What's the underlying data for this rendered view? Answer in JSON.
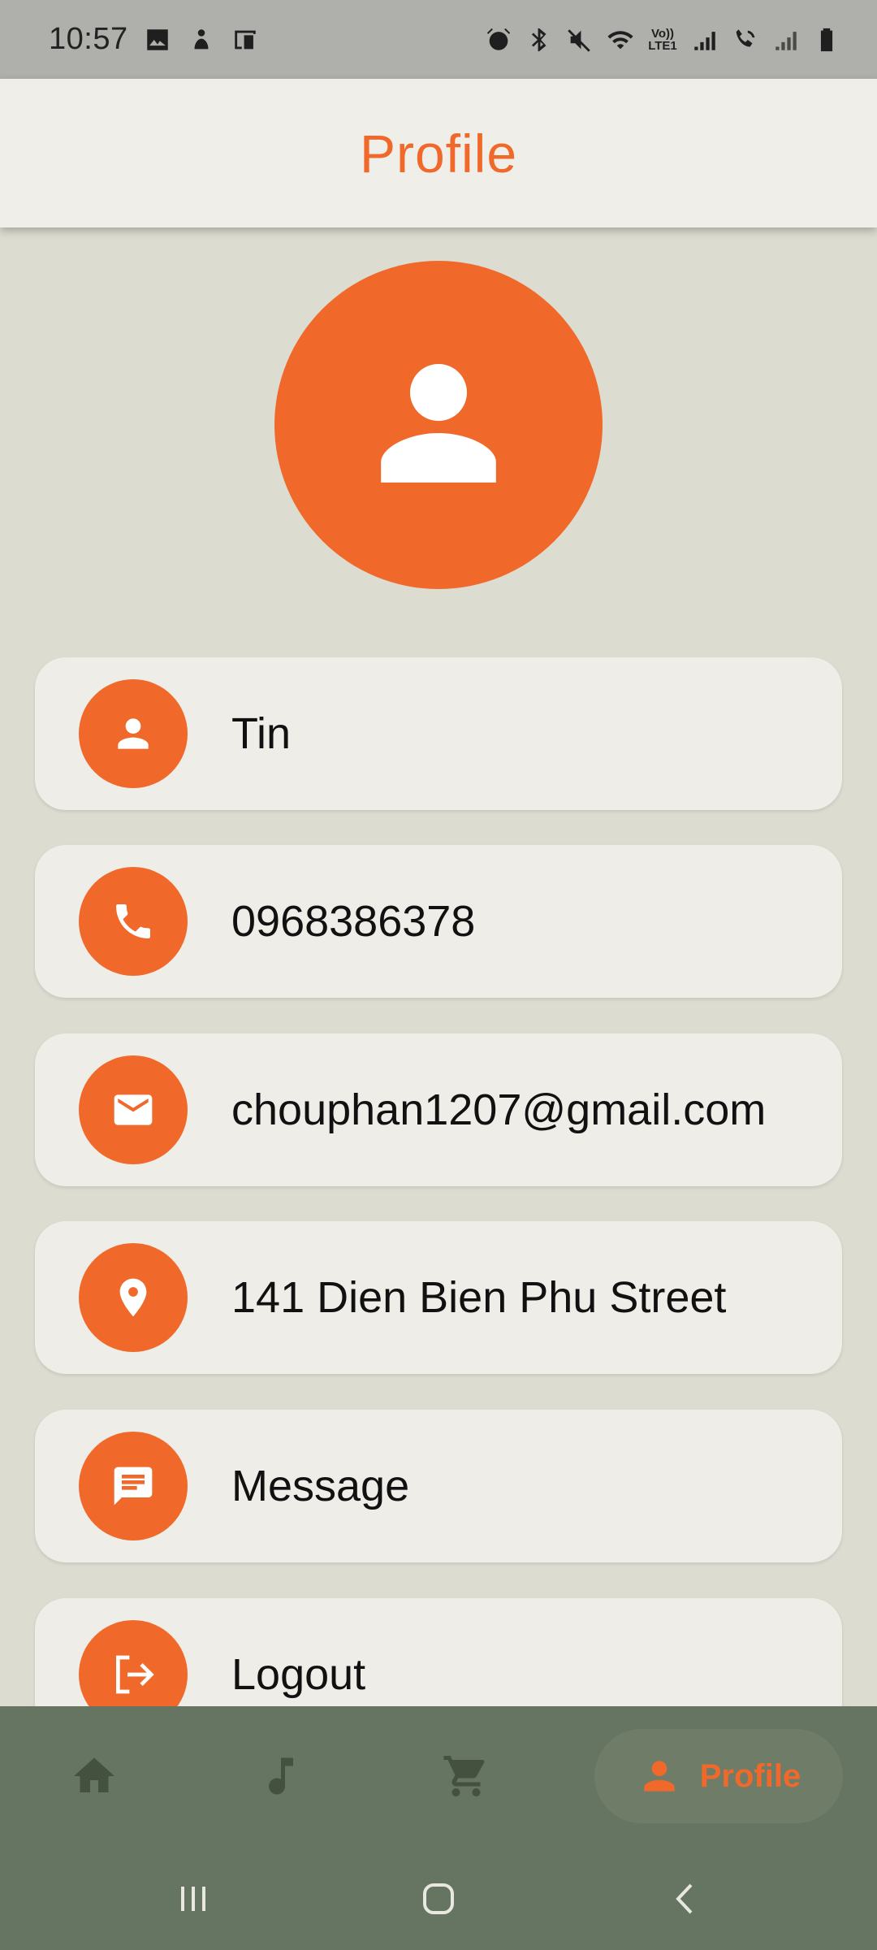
{
  "status_bar": {
    "time": "10:57",
    "left_icons": [
      "gallery-icon",
      "notification-icon",
      "screen-mirror-icon"
    ],
    "right_icons": [
      "alarm-icon",
      "bluetooth-icon",
      "mute-icon",
      "wifi-icon",
      "signal-icon",
      "wifi-calling-icon",
      "signal-icon",
      "battery-icon"
    ],
    "volte_label_top": "Vo))",
    "volte_label_bottom": "LTE1"
  },
  "app_bar": {
    "title": "Profile"
  },
  "profile": {
    "avatar_icon": "person-icon",
    "items": [
      {
        "icon": "person-icon",
        "text": "Tin"
      },
      {
        "icon": "phone-icon",
        "text": "0968386378"
      },
      {
        "icon": "mail-icon",
        "text": "chouphan1207@gmail.com"
      },
      {
        "icon": "location-pin-icon",
        "text": "141 Dien Bien Phu Street"
      },
      {
        "icon": "message-icon",
        "text": "Message"
      },
      {
        "icon": "logout-icon",
        "text": "Logout"
      }
    ]
  },
  "bottom_nav": {
    "items": [
      {
        "icon": "home-icon",
        "label": ""
      },
      {
        "icon": "music-note-icon",
        "label": ""
      },
      {
        "icon": "cart-icon",
        "label": ""
      },
      {
        "icon": "person-icon",
        "label": "Profile",
        "active": true
      }
    ]
  },
  "colors": {
    "accent": "#f0692b",
    "background": "#dcdcd0",
    "card": "#eeede7",
    "nav": "#667462"
  }
}
